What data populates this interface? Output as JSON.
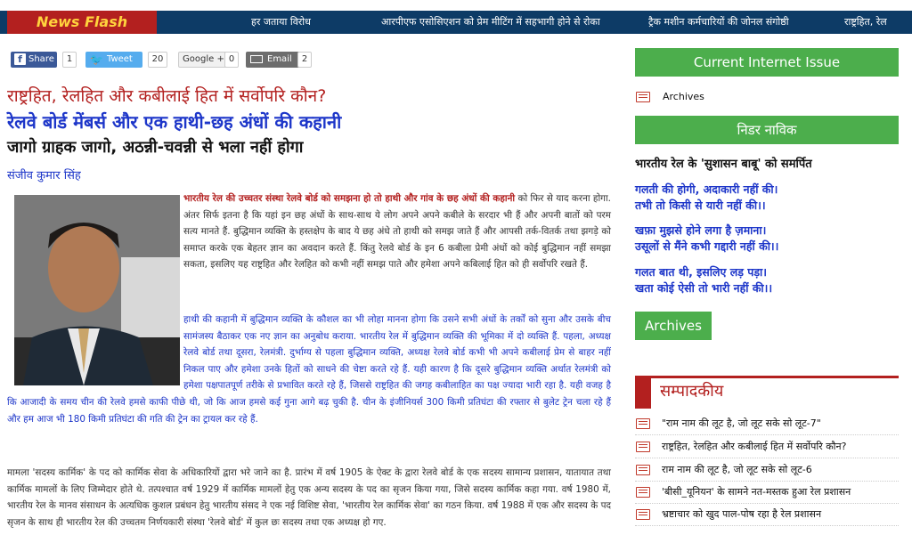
{
  "news_flash": {
    "label": "News Flash",
    "items": [
      "हर जताया विरोध",
      "आरपीएफ एसोसिएशन को प्रेम मीटिंग में सहभागी होने से रोका",
      "ट्रैक मशीन कर्मचारियों की जोनल संगोष्ठी",
      "राष्ट्रहित, रेल"
    ]
  },
  "share_bar": {
    "facebook": {
      "label": "Share",
      "count": "1"
    },
    "twitter": {
      "label": "Tweet",
      "count": "20"
    },
    "google": {
      "label": "Google +",
      "count": "0"
    },
    "email": {
      "label": "Email",
      "count": "2"
    }
  },
  "article": {
    "heading_red": "राष्ट्रहित, रेलहित और कबीलाई हित में सर्वोपरि कौन?",
    "heading_blue": "रेलवे बोर्ड मेंबर्स और एक हाथी-छह अंधों की कहानी",
    "heading_black": "जागो ग्राहक जागो, अठन्नी-चवन्नी से भला नहीं होगा",
    "author": "संजीव कुमार सिंह",
    "para1_bold": "भारतीय रेल की उच्चतर संस्था रेलवे बोर्ड को समझना हो तो हाथी और गांव के छह अंधों की कहानी",
    "para1_rest": " को फिर से याद करना होगा. अंतर सिर्फ इतना है कि यहां इन छह अंधों के साथ-साथ ये लोग अपने अपने कबीले के सरदार भी हैं और अपनी बातों को परम सत्य मानते हैं. बुद्धिमान व्यक्ति के हस्तक्षेप के बाद ये छह अंधे तो हाथी को समझ जाते हैं और आपसी तर्क-वितर्क तथा झगड़े को समाप्त करके एक बेहतर ज्ञान का अवदान करते हैं. किंतु रेलवे बोर्ड के इन 6 कबीला प्रेमी अंधों को कोई बुद्धिमान नहीं समझा सकता, इसलिए यह राष्ट्रहित और रेलहित को कभी नहीं समझ पाते और हमेशा अपने कबिलाई हित को ही सर्वोपरि रखते हैं.",
    "para2": "हाथी की कहानी में बुद्धिमान व्यक्ति के कौशल का भी लोहा मानना होगा कि उसने सभी अंधों के तर्कों को सुना और उसके बीच सामंजस्य बैठाकर एक नए ज्ञान का अनुबोध कराया. भारतीय रेल में बुद्धिमान व्यक्ति की भूमिका में दो व्यक्ति हैं. पहला, अध्यक्ष रेलवे बोर्ड तथा दूसरा, रेलमंत्री. दुर्भाग्य से पहला बुद्धिमान व्यक्ति, अध्यक्ष रेलवे बोर्ड कभी भी अपने कबीलाई प्रेम से बाहर नहीं निकल पाए और हमेशा उनके हितों को साधने की चेष्टा करते रहे हैं. यही कारण है कि दूसरे बुद्धिमान व्यक्ति अर्थात रेलमंत्री को हमेशा पक्षपातपूर्ण तरीके से प्रभावित करते रहे हैं, जिससे राष्ट्रहित की जगह कबीलाहित का पक्ष ज्यादा भारी रहा है. यही वजह है कि आजादी के समय चीन की रेलवे हमसे काफी पीछे थी, जो कि आज हमसे कई गुना आगे बढ़ चुकी है. चीन के इंजीनियर्स 300 किमी प्रतिघंटा की रफ्तार से बुलेट ट्रेन चला रहे हैं और हम आज भी 180 किमी प्रतिघंटा की गति की ट्रेन का ट्रायल कर रहे हैं.",
    "para3": "मामला 'सदस्य कार्मिक' के पद को कार्मिक सेवा के अधिकारियों द्वारा भरे जाने का है. प्रारंभ में वर्ष 1905 के ऐक्ट के द्वारा रेलवे बोर्ड के एक सदस्य सामान्य प्रशासन, यातायात तथा कार्मिक मामलों के लिए जिम्मेदार होते थे. तत्पश्चात वर्ष 1929 में कार्मिक मामलों हेतु एक अन्य सदस्य के पद का सृजन किया गया, जिसे सदस्य कार्मिक कहा गया. वर्ष 1980 में, भारतीय रेल के मानव संसाधन के अत्यधिक कुशल प्रबंधन हेतु भारतीय संसद ने एक नई विशिष्ट सेवा, 'भारतीय रेल कार्मिक सेवा' का गठन किया. वर्ष 1988 में एक और सदस्य के पद सृजन के साथ ही भारतीय रेल की उच्चतम निर्णयकारी संस्था 'रेलवे बोर्ड' में कुल छः सदस्य तथा एक अध्यक्ष हो गए."
  },
  "sidebar": {
    "current_issue": "Current Internet Issue",
    "archives_link": "Archives",
    "nidar_navik": "निडर नाविक",
    "poem_title": "भारतीय रेल के 'सुशासन बाबू' को समर्पित",
    "poem_lines": [
      "गलती की होगी, अदाकारी नहीं की।",
      "तभी तो किसी से यारी नहीं की।।",
      "खफ़ा मुझसे होने लगा है ज़माना।",
      "उसूलों से मैंने कभी गद्दारी नहीं की।।",
      "गलत बात थी, इसलिए लड़ पड़ा।",
      "खता कोई ऐसी तो भारी नहीं की।।"
    ],
    "archives_button": "Archives",
    "editorial_title": "सम्पादकीय",
    "editorial_items": [
      "\"राम नाम की लूट है, जो लूट सके सो लूट-7\"",
      "राष्ट्रहित, रेलहित और कबीलाई हित में सर्वोपरि कौन?",
      "राम नाम की लूट है, जो लूट सके सो लूट-6",
      "'बीसी_यूनियन' के सामने नत-मस्तक हुआ रेल प्रशासन",
      "भ्रष्टाचार को खुद पाल-पोष रहा है रेल प्रशासन"
    ]
  }
}
